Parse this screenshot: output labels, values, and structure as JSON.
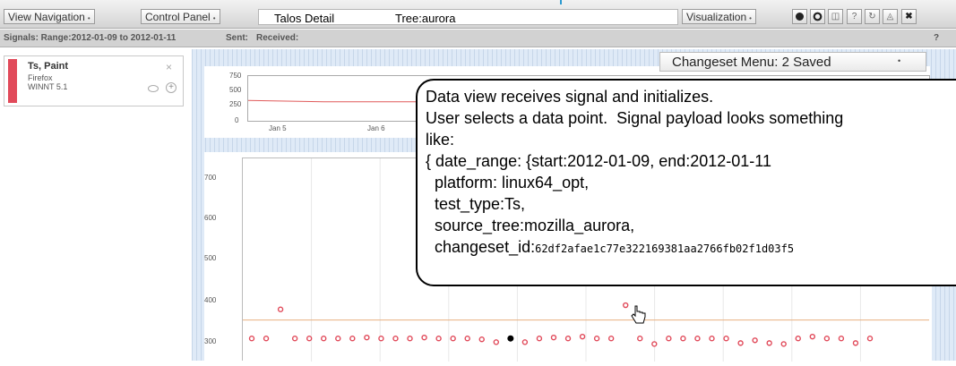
{
  "toolbar": {
    "view_navigation": "View Navigation",
    "control_panel": "Control Panel",
    "title": "Talos Detail",
    "tree": "Tree:aurora",
    "visualization": "Visualization",
    "dropdown_arrow": "•",
    "icons": [
      "record-icon",
      "record-outline-icon",
      "link-icon",
      "help-icon",
      "refresh-icon",
      "unlink-icon",
      "close-icon"
    ]
  },
  "signals": {
    "range_label": "Signals: Range:2012-01-09 to 2012-01-11",
    "sent_label": "Sent:",
    "received_label": "Received:",
    "help": "?"
  },
  "series_card": {
    "title": "Ts, Paint",
    "browser": "Firefox",
    "platform": "WINNT 5.1",
    "color": "#e14a5a"
  },
  "changeset_menu": {
    "label": "Changeset Menu: 2 Saved",
    "arrow": "•"
  },
  "callout": {
    "line1": "Data view receives signal and initializes.",
    "line2": "User selects a data point.  Signal payload looks something",
    "line3": "like:",
    "line4": "{ date_range: {start:2012-01-09, end:2012-01-11",
    "line5": "  platform: linux64_opt,",
    "line6": "  test_type:Ts,",
    "line7": "  source_tree:mozilla_aurora,",
    "line8_prefix": "  changeset_id:",
    "changeset_id": "62df2afae1c77e322169381aa2766fb02f1d03f5"
  },
  "chart_data": [
    {
      "type": "line",
      "ylim": [
        0,
        750
      ],
      "yticks": [
        "750",
        "500",
        "250",
        "0"
      ],
      "xticks": [
        "Jan 5",
        "Jan 6"
      ],
      "series": [
        {
          "values": [
            340,
            320,
            320,
            320,
            320,
            320,
            320,
            320,
            320,
            320
          ]
        }
      ],
      "line_color": "#e05a5a"
    },
    {
      "type": "scatter",
      "ylim": [
        280,
        720
      ],
      "yticks": [
        "700",
        "600",
        "500",
        "400",
        "300"
      ],
      "reference_line": 370,
      "reference_color": "#e8b080",
      "point_color": "#e14a5a",
      "selected_color": "#000000",
      "values": [
        330,
        330,
        393,
        330,
        330,
        330,
        330,
        330,
        332,
        330,
        330,
        330,
        332,
        330,
        330,
        330,
        328,
        322,
        330,
        322,
        330,
        332,
        330,
        334,
        330,
        330,
        402,
        330,
        318,
        330,
        330,
        330,
        330,
        330,
        320,
        326,
        320,
        318,
        330,
        334,
        330,
        330,
        320,
        330
      ],
      "selected_index": 18
    }
  ]
}
